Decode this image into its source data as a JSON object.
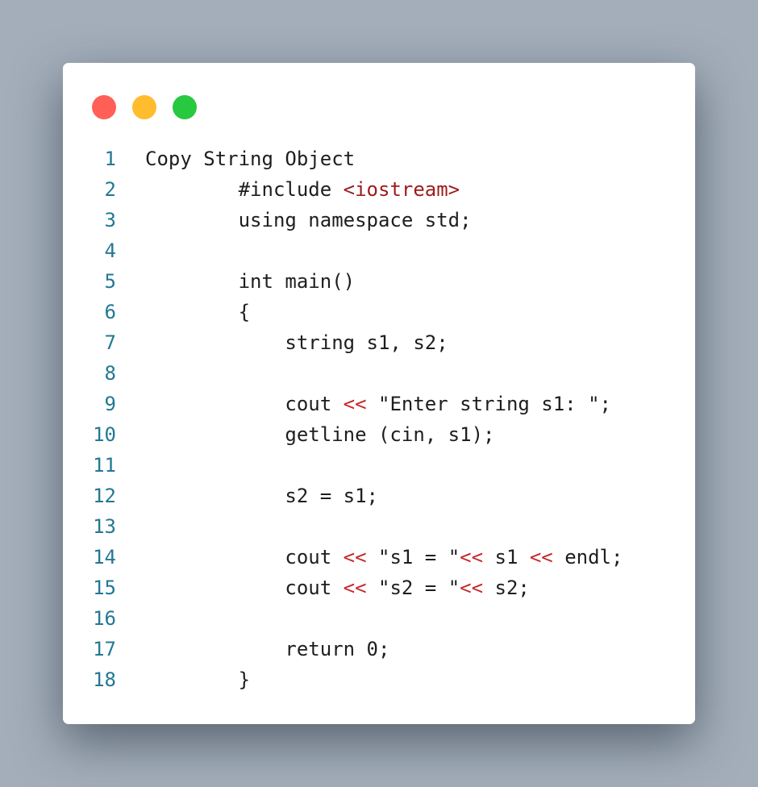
{
  "window": {
    "traffic_lights": [
      {
        "name": "close-dot",
        "color": "#ff5f57"
      },
      {
        "name": "minimize-dot",
        "color": "#febc2e"
      },
      {
        "name": "maximize-dot",
        "color": "#28c840"
      }
    ]
  },
  "colors": {
    "background": "#a3aeba",
    "line_number": "#237893",
    "text": "#1e1e1e",
    "include_path": "#9b1c1c",
    "operator": "#c62828"
  },
  "code": {
    "lines": [
      {
        "num": "1",
        "tokens": [
          {
            "t": "Copy String Object",
            "c": "plain"
          }
        ]
      },
      {
        "num": "2",
        "tokens": [
          {
            "t": "        #include ",
            "c": "plain"
          },
          {
            "t": "<iostream>",
            "c": "inc"
          }
        ]
      },
      {
        "num": "3",
        "tokens": [
          {
            "t": "        using namespace std;",
            "c": "plain"
          }
        ]
      },
      {
        "num": "4",
        "tokens": []
      },
      {
        "num": "5",
        "tokens": [
          {
            "t": "        int main()",
            "c": "plain"
          }
        ]
      },
      {
        "num": "6",
        "tokens": [
          {
            "t": "        {",
            "c": "plain"
          }
        ]
      },
      {
        "num": "7",
        "tokens": [
          {
            "t": "            string s1, s2;",
            "c": "plain"
          }
        ]
      },
      {
        "num": "8",
        "tokens": []
      },
      {
        "num": "9",
        "tokens": [
          {
            "t": "            cout ",
            "c": "plain"
          },
          {
            "t": "<<",
            "c": "op"
          },
          {
            "t": " \"Enter string s1: \";",
            "c": "plain"
          }
        ]
      },
      {
        "num": "10",
        "tokens": [
          {
            "t": "            getline (cin, s1);",
            "c": "plain"
          }
        ]
      },
      {
        "num": "11",
        "tokens": []
      },
      {
        "num": "12",
        "tokens": [
          {
            "t": "            s2 = s1;",
            "c": "plain"
          }
        ]
      },
      {
        "num": "13",
        "tokens": []
      },
      {
        "num": "14",
        "tokens": [
          {
            "t": "            cout ",
            "c": "plain"
          },
          {
            "t": "<<",
            "c": "op"
          },
          {
            "t": " \"s1 = \"",
            "c": "plain"
          },
          {
            "t": "<<",
            "c": "op"
          },
          {
            "t": " s1 ",
            "c": "plain"
          },
          {
            "t": "<<",
            "c": "op"
          },
          {
            "t": " endl;",
            "c": "plain"
          }
        ]
      },
      {
        "num": "15",
        "tokens": [
          {
            "t": "            cout ",
            "c": "plain"
          },
          {
            "t": "<<",
            "c": "op"
          },
          {
            "t": " \"s2 = \"",
            "c": "plain"
          },
          {
            "t": "<<",
            "c": "op"
          },
          {
            "t": " s2;",
            "c": "plain"
          }
        ]
      },
      {
        "num": "16",
        "tokens": []
      },
      {
        "num": "17",
        "tokens": [
          {
            "t": "            return 0;",
            "c": "plain"
          }
        ]
      },
      {
        "num": "18",
        "tokens": [
          {
            "t": "        }",
            "c": "plain"
          }
        ]
      }
    ]
  }
}
